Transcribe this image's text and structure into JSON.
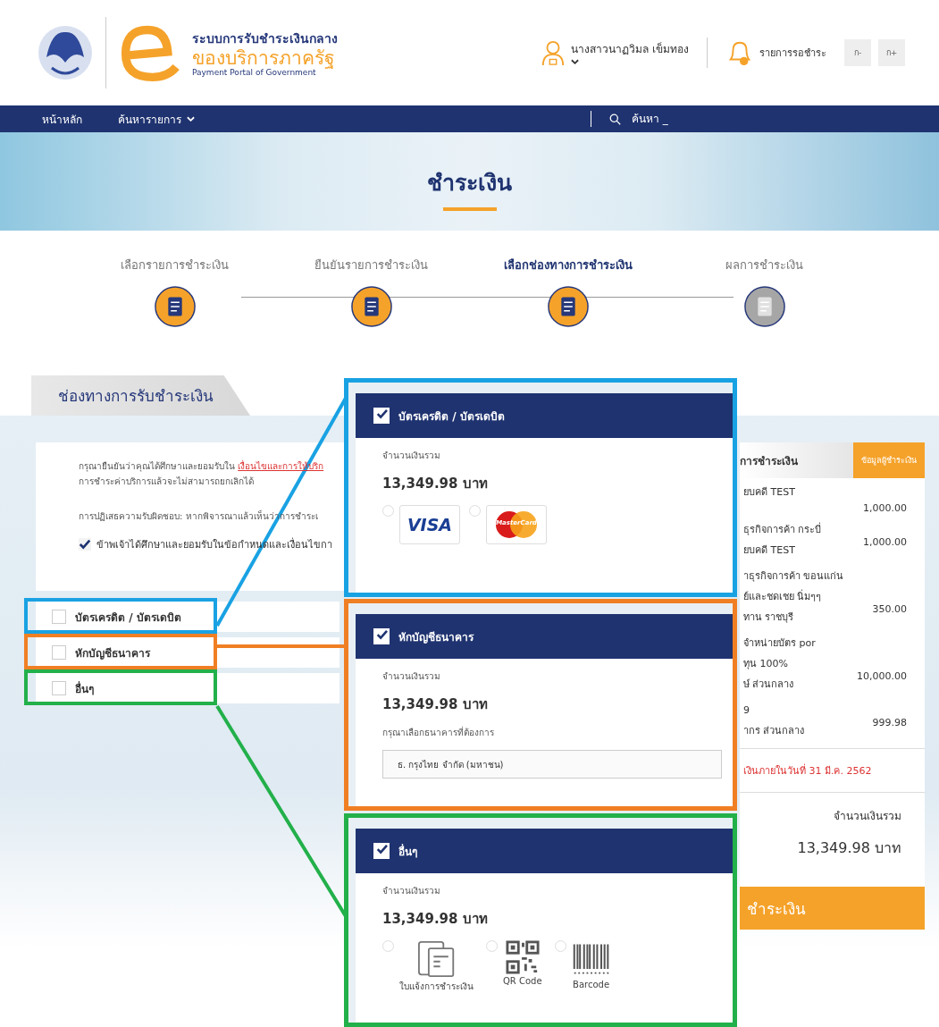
{
  "header": {
    "org_title": "ระบบการรับชำระเงินกลาง",
    "org_subtitle": "ของบริการภาครัฐ",
    "org_english": "Payment Portal of Government",
    "user_name": "นางสาวนาฏวิมล เข็มทอง",
    "pending_label": "รายการรอชำระ",
    "font_buttons": [
      "ก-",
      "ก+"
    ]
  },
  "nav": {
    "items": [
      {
        "label": "หน้าหลัก",
        "dropdown": false
      },
      {
        "label": "ค้นหารายการ",
        "dropdown": true
      }
    ],
    "search_placeholder": "ค้นหา _"
  },
  "banner": {
    "title": "ชำระเงิน"
  },
  "steps": [
    {
      "label": "เลือกรายการชำระเงิน",
      "completed": true,
      "selected": false
    },
    {
      "label": "ยืนยันรายการชำระเงิน",
      "completed": true,
      "selected": false
    },
    {
      "label": "เลือกช่องทางการชำระเงิน",
      "completed": true,
      "selected": true
    },
    {
      "label": "ผลการชำระเงิน",
      "completed": false,
      "selected": false
    }
  ],
  "section": {
    "tab_label": "ช่องทางการรับชำระเงิน"
  },
  "terms": {
    "line1": "กรุณายืนยันว่าคุณได้ศึกษาและยอมรับใน",
    "link": "เงื่อนไขและการให้บริก",
    "line2": "การชำระค่าบริการแล้วจะไม่สามารถยกเลิกได้",
    "disclaimer": "การปฏิเสธความรับผิดชอบ: หากพิจารณาแล้วเห็นว่าการชำระเ",
    "agree_label": "ข้าพเจ้าได้ศึกษาและยอมรับในข้อกำหนดและเงื่อนไขกา",
    "agree_checked": true
  },
  "options": [
    {
      "label": "บัตรเครดิต / บัตรเดบิต",
      "checked": false,
      "color": "#19a2e3"
    },
    {
      "label": "หักบัญชีธนาคาร",
      "checked": false,
      "color": "#f07f24"
    },
    {
      "label": "อื่นๆ",
      "checked": false,
      "color": "#22b04a"
    }
  ],
  "callouts": [
    {
      "kind": "card",
      "title": "บัตรเครดิต / บัตรเดบิต",
      "checked": true,
      "color": "#19a2e3",
      "amount_label": "จำนวนเงินรวม",
      "amount": "13,349.98 บาท",
      "cards": [
        {
          "kind": "visa",
          "label": "VISA",
          "selected": false
        },
        {
          "kind": "mastercard",
          "label": "MasterCard",
          "selected": false
        }
      ]
    },
    {
      "kind": "bank",
      "title": "หักบัญชีธนาคาร",
      "checked": true,
      "color": "#f07f24",
      "amount_label": "จำนวนเงินรวม",
      "amount": "13,349.98 บาท",
      "bank_label": "กรุณาเลือกธนาคารที่ต้องการ",
      "bank_value": "ธ. กรุงไทย จำกัด (มหาชน)"
    },
    {
      "kind": "other",
      "title": "อื่นๆ",
      "checked": true,
      "color": "#22b04a",
      "amount_label": "จำนวนเงินรวม",
      "amount": "13,349.98 บาท",
      "methods": [
        {
          "kind": "invoice",
          "label": "ใบแจ้งการชำระเงิน",
          "selected": false
        },
        {
          "kind": "qr",
          "label": "QR Code",
          "selected": false
        },
        {
          "kind": "barcode",
          "label": "Barcode",
          "selected": false
        }
      ]
    }
  ],
  "summary": {
    "header": "การชำระเงิน",
    "tag": "ข้อมูลผู้ชำระเงิน",
    "items": [
      {
        "lines": [
          "ยบคดี TEST"
        ],
        "amount": "1,000.00"
      },
      {
        "lines": [
          "ธุรกิจการค้า กระบี่",
          "ยบคดี TEST"
        ],
        "amount": "1,000.00"
      },
      {
        "lines": [
          "าธุรกิจการค้า ขอนแก่น",
          "ย์และชดเชย นิ่มๆๆ",
          "ทาน ราชบุรี"
        ],
        "amount": "350.00"
      },
      {
        "lines": [
          "จำหน่ายบัตร por",
          "ทุน 100%",
          "ษ์ ส่วนกลาง"
        ],
        "amount": "10,000.00"
      },
      {
        "lines": [
          "9",
          "ากร ส่วนกลาง"
        ],
        "amount": "999.98"
      }
    ],
    "deadline": "เงินภายในวันที่ 31 มี.ค. 2562",
    "total_label": "จำนวนเงินรวม",
    "total": "13,349.98 บาท",
    "pay_button": "ชำระเงิน"
  }
}
